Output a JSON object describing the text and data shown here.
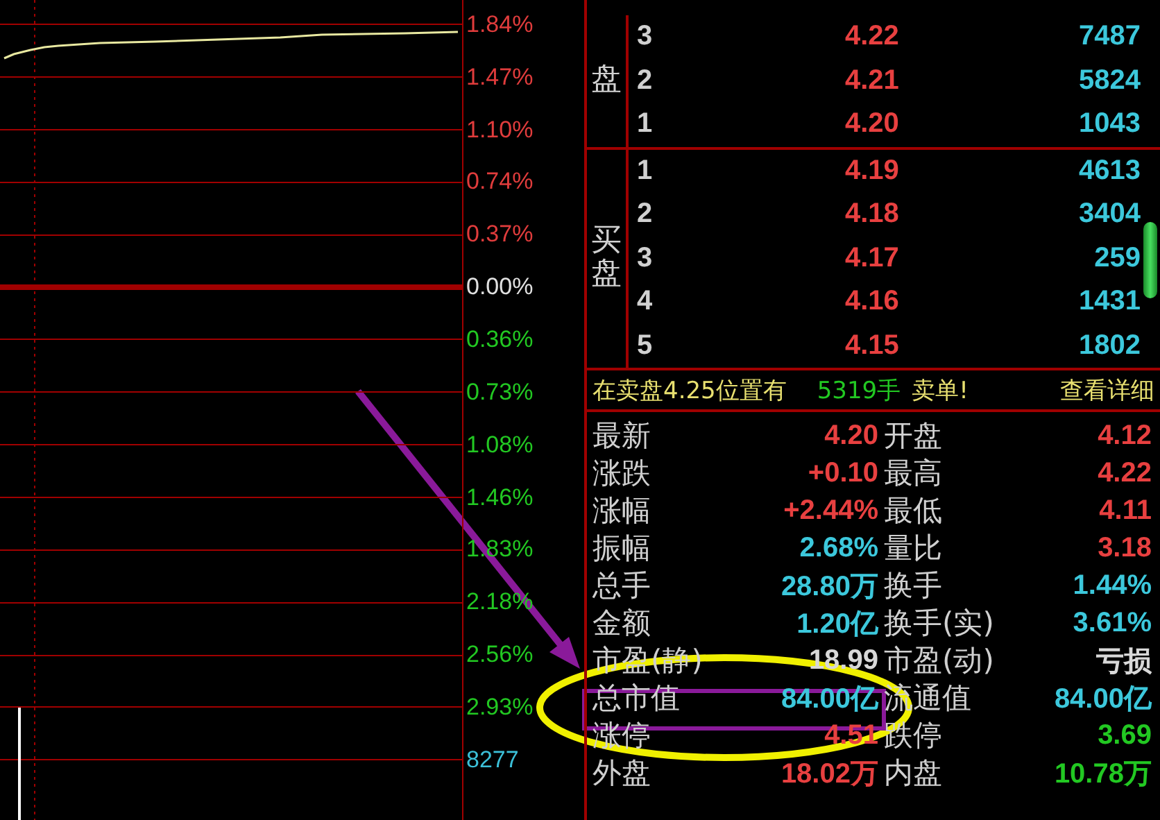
{
  "chart": {
    "axis_labels": [
      {
        "text": "1.84%",
        "color": "#e03c3c",
        "baseline": false
      },
      {
        "text": "1.47%",
        "color": "#e03c3c",
        "baseline": false
      },
      {
        "text": "1.10%",
        "color": "#e03c3c",
        "baseline": false
      },
      {
        "text": "0.74%",
        "color": "#e03c3c",
        "baseline": false
      },
      {
        "text": "0.37%",
        "color": "#e03c3c",
        "baseline": false
      },
      {
        "text": "0.00%",
        "color": "#e0e0e0",
        "baseline": true
      },
      {
        "text": "0.36%",
        "color": "#22c822",
        "baseline": false
      },
      {
        "text": "0.73%",
        "color": "#22c822",
        "baseline": false
      },
      {
        "text": "1.08%",
        "color": "#22c822",
        "baseline": false
      },
      {
        "text": "1.46%",
        "color": "#22c822",
        "baseline": false
      },
      {
        "text": "1.83%",
        "color": "#22c822",
        "baseline": false
      },
      {
        "text": "2.18%",
        "color": "#22c822",
        "baseline": false
      },
      {
        "text": "2.56%",
        "color": "#22c822",
        "baseline": false
      },
      {
        "text": "2.93%",
        "color": "#22c822",
        "baseline": false
      },
      {
        "text": "8277",
        "color": "#3cc0d8",
        "baseline": false
      }
    ]
  },
  "order_book": {
    "sell": {
      "label": "盘",
      "rows": [
        {
          "level": "3",
          "price": "4.22",
          "volume": "7487"
        },
        {
          "level": "2",
          "price": "4.21",
          "volume": "5824"
        },
        {
          "level": "1",
          "price": "4.20",
          "volume": "1043"
        }
      ]
    },
    "buy": {
      "label": "买盘",
      "rows": [
        {
          "level": "1",
          "price": "4.19",
          "volume": "4613"
        },
        {
          "level": "2",
          "price": "4.18",
          "volume": "3404"
        },
        {
          "level": "3",
          "price": "4.17",
          "volume": "259"
        },
        {
          "level": "4",
          "price": "4.16",
          "volume": "1431"
        },
        {
          "level": "5",
          "price": "4.15",
          "volume": "1802"
        }
      ]
    }
  },
  "notice": {
    "text": "在卖盘4.25位置有",
    "quantity": "5319手",
    "suffix": "卖单!",
    "link": "查看详细"
  },
  "stats": [
    {
      "cells": [
        {
          "label": "最新",
          "value": "4.20",
          "color": "#e84040"
        },
        {
          "label": "开盘",
          "value": "4.12",
          "color": "#e84040"
        }
      ]
    },
    {
      "cells": [
        {
          "label": "涨跌",
          "value": "+0.10",
          "color": "#e84040"
        },
        {
          "label": "最高",
          "value": "4.22",
          "color": "#e84040"
        }
      ]
    },
    {
      "cells": [
        {
          "label": "涨幅",
          "value": "+2.44%",
          "color": "#e84040"
        },
        {
          "label": "最低",
          "value": "4.11",
          "color": "#e84040"
        }
      ]
    },
    {
      "cells": [
        {
          "label": "振幅",
          "value": "2.68%",
          "color": "#3cc8dc"
        },
        {
          "label": "量比",
          "value": "3.18",
          "color": "#e84040"
        }
      ]
    },
    {
      "cells": [
        {
          "label": "总手",
          "value": "28.80万",
          "color": "#3cc8dc"
        },
        {
          "label": "换手",
          "value": "1.44%",
          "color": "#3cc8dc"
        }
      ]
    },
    {
      "cells": [
        {
          "label": "金额",
          "value": "1.20亿",
          "color": "#3cc8dc"
        },
        {
          "label": "换手(实)",
          "value": "3.61%",
          "color": "#3cc8dc"
        }
      ]
    },
    {
      "cells": [
        {
          "label": "市盈(静)",
          "value": "18.99",
          "color": "#d8d8d8"
        },
        {
          "label": "市盈(动)",
          "value": "亏损",
          "color": "#d8d8d8"
        }
      ]
    },
    {
      "cells": [
        {
          "label": "总市值",
          "value": "84.00亿",
          "color": "#3cc8dc"
        },
        {
          "label": "流通值",
          "value": "84.00亿",
          "color": "#3cc8dc"
        }
      ]
    },
    {
      "cells": [
        {
          "label": "涨停",
          "value": "4.51",
          "color": "#e84040"
        },
        {
          "label": "跌停",
          "value": "3.69",
          "color": "#22c822"
        }
      ]
    },
    {
      "cells": [
        {
          "label": "外盘",
          "value": "18.02万",
          "color": "#e84040"
        },
        {
          "label": "内盘",
          "value": "10.78万",
          "color": "#22c822"
        }
      ]
    }
  ]
}
